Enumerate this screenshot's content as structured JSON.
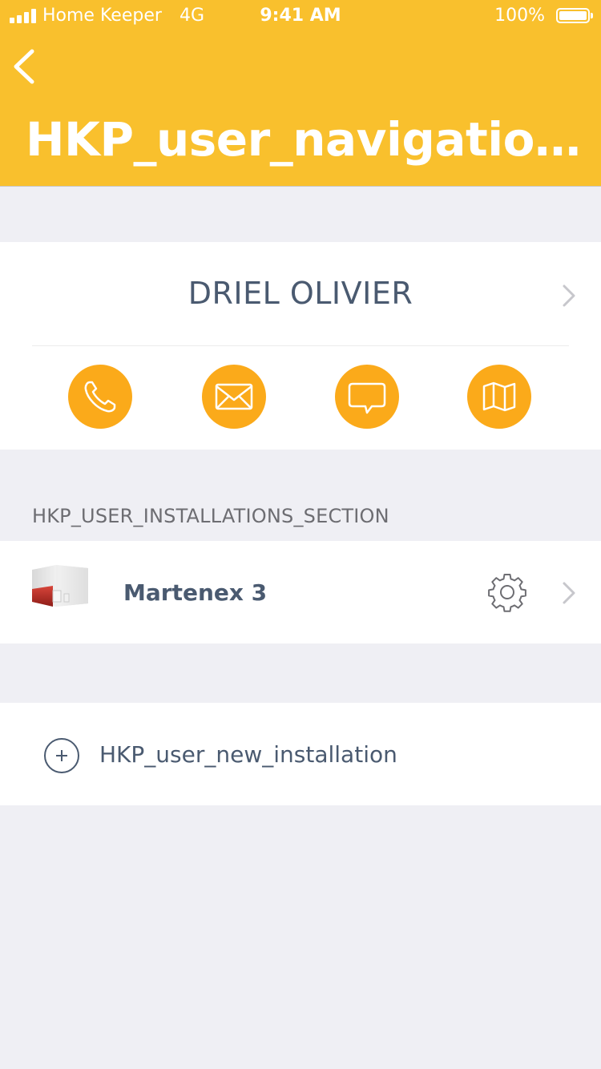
{
  "status_bar": {
    "carrier": "Home Keeper",
    "network": "4G",
    "time": "9:41 AM",
    "battery": "100%"
  },
  "header": {
    "title": "HKP_user_navigation_ti...",
    "back_icon": "chevron-left-icon",
    "background_color": "#f9c02d"
  },
  "contact": {
    "name": "DRIEL OLIVIER",
    "accent_color": "#fbaa1a",
    "actions": [
      {
        "icon": "phone-icon"
      },
      {
        "icon": "mail-icon"
      },
      {
        "icon": "message-icon"
      },
      {
        "icon": "map-icon"
      }
    ]
  },
  "installations": {
    "section_title": "HKP_USER_INSTALLATIONS_SECTION",
    "items": [
      {
        "name": "Martenex 3",
        "image": "device-image",
        "settings_icon": "gear-icon"
      }
    ]
  },
  "new_installation": {
    "label": "HKP_user_new_installation",
    "icon": "plus-circle-icon"
  }
}
